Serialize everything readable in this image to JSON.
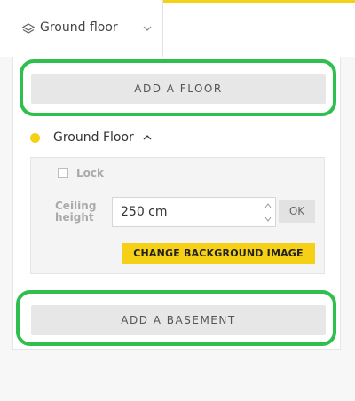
{
  "header": {
    "floor_selector_label": "Ground floor",
    "accent_color": "#f5d016"
  },
  "panel": {
    "add_floor_label": "ADD A FLOOR",
    "add_basement_label": "ADD A BASEMENT",
    "highlight_color": "#2ebf4f",
    "floor": {
      "name": "Ground Floor",
      "dot_color": "#f5d016",
      "lock_label": "Lock",
      "lock_checked": false,
      "ceiling_label": "Ceiling height",
      "ceiling_value": "250 cm",
      "ok_label": "OK",
      "change_background_label": "CHANGE BACKGROUND IMAGE"
    }
  },
  "icons": {
    "floor_selector": "layers-icon",
    "dropdown": "chevron-down-icon",
    "collapse": "chevron-up-icon",
    "spinner_up": "spinner-up-icon",
    "spinner_down": "spinner-down-icon"
  }
}
